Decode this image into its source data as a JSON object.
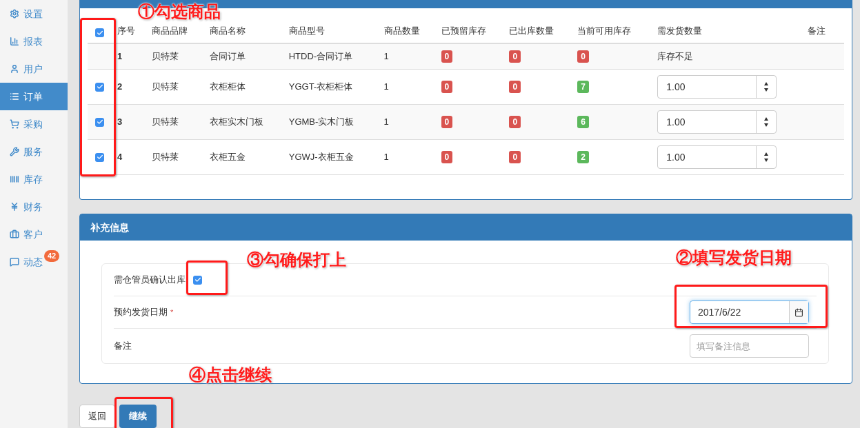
{
  "sidebar": {
    "items": [
      {
        "label": "设置",
        "selected": false
      },
      {
        "label": "报表",
        "selected": false
      },
      {
        "label": "用户",
        "selected": false
      },
      {
        "label": "订单",
        "selected": true
      },
      {
        "label": "采购",
        "selected": false
      },
      {
        "label": "服务",
        "selected": false
      },
      {
        "label": "库存",
        "selected": false
      },
      {
        "label": "财务",
        "selected": false
      },
      {
        "label": "客户",
        "selected": false
      },
      {
        "label": "动态",
        "selected": false,
        "badge": "42"
      }
    ]
  },
  "products_table": {
    "header_checked": true,
    "columns": [
      "序号",
      "商品品牌",
      "商品名称",
      "商品型号",
      "商品数量",
      "已预留库存",
      "已出库数量",
      "当前可用库存",
      "需发货数量",
      "备注"
    ],
    "rows": [
      {
        "selectable": false,
        "index": "1",
        "brand": "贝特莱",
        "name": "合同订单",
        "model": "HTDD-合同订单",
        "quantity": "1",
        "reserved": {
          "text": "0",
          "color": "#d9534f"
        },
        "shipped": {
          "text": "0",
          "color": "#d9534f"
        },
        "available": {
          "text": "0",
          "color": "#d9534f"
        },
        "ship_quantity": {
          "kind": "text",
          "text": "库存不足"
        }
      },
      {
        "selectable": true,
        "checked": true,
        "index": "2",
        "brand": "贝特莱",
        "name": "衣柜柜体",
        "model": "YGGT-衣柜柜体",
        "quantity": "1",
        "reserved": {
          "text": "0",
          "color": "#d9534f"
        },
        "shipped": {
          "text": "0",
          "color": "#d9534f"
        },
        "available": {
          "text": "7",
          "color": "#5cb85c"
        },
        "ship_quantity": {
          "kind": "spinner",
          "value": "1.00"
        }
      },
      {
        "selectable": true,
        "checked": true,
        "index": "3",
        "brand": "贝特莱",
        "name": "衣柜实木门板",
        "model": "YGMB-实木门板",
        "quantity": "1",
        "reserved": {
          "text": "0",
          "color": "#d9534f"
        },
        "shipped": {
          "text": "0",
          "color": "#d9534f"
        },
        "available": {
          "text": "6",
          "color": "#5cb85c"
        },
        "ship_quantity": {
          "kind": "spinner",
          "value": "1.00"
        }
      },
      {
        "selectable": true,
        "checked": true,
        "index": "4",
        "brand": "贝特莱",
        "name": "衣柜五金",
        "model": "YGWJ-衣柜五金",
        "quantity": "1",
        "reserved": {
          "text": "0",
          "color": "#d9534f"
        },
        "shipped": {
          "text": "0",
          "color": "#d9534f"
        },
        "available": {
          "text": "2",
          "color": "#5cb85c"
        },
        "ship_quantity": {
          "kind": "spinner",
          "value": "1.00"
        }
      }
    ]
  },
  "supplement_panel": {
    "title": "补充信息",
    "fields": [
      {
        "kind": "checkbox",
        "label": "需仓管员确认出库",
        "checked": true
      },
      {
        "kind": "date",
        "label": "预约发货日期",
        "required_mark": "*",
        "value": "2017/6/22"
      },
      {
        "kind": "text",
        "label": "备注",
        "placeholder": "填写备注信息"
      }
    ]
  },
  "buttons": [
    {
      "label": "返回",
      "primary": false
    },
    {
      "label": "继续",
      "primary": true
    }
  ],
  "annotations": [
    {
      "text": "①勾选商品"
    },
    {
      "text": "③勾确保打上"
    },
    {
      "text": "②填写发货日期"
    },
    {
      "text": "④点击继续"
    }
  ]
}
